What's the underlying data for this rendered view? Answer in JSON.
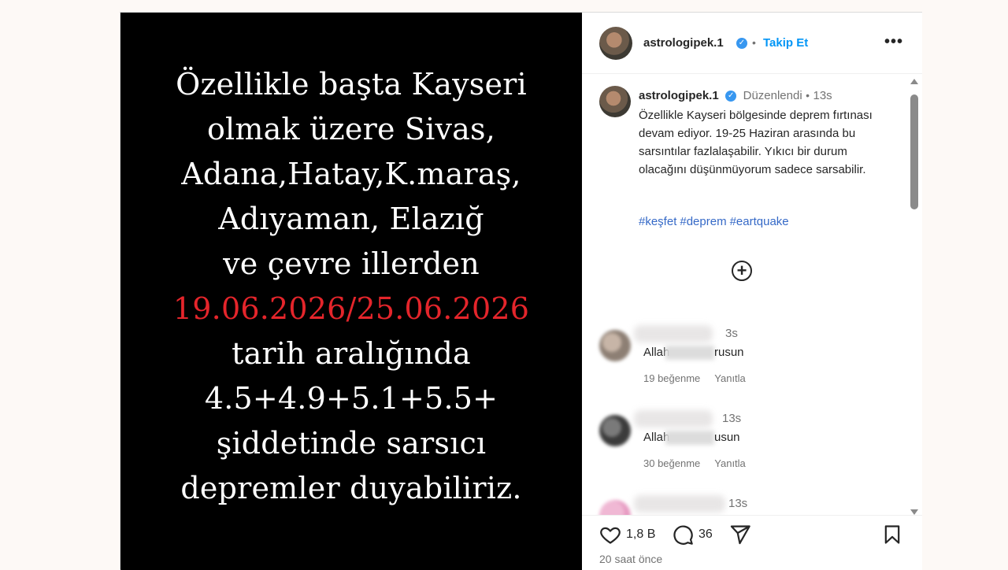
{
  "media": {
    "lines": [
      "Özellikle başta Kayseri",
      "olmak üzere Sivas,",
      "Adana,Hatay,K.maraş,",
      "Adıyaman, Elazığ",
      "ve çevre illerden",
      "19.06.2026/25.06.2026",
      "tarih aralığında",
      "4.5+4.9+5.1+5.5+",
      "şiddetinde sarsıcı",
      "depremler duyabiliriz."
    ],
    "highlight_color": "#e4252b"
  },
  "header": {
    "username": "astrologipek.1",
    "separator": "•",
    "follow_label": "Takip Et",
    "more_label": "•••"
  },
  "caption": {
    "username": "astrologipek.1",
    "edited": "Düzenlendi",
    "separator": "•",
    "time": "13s",
    "text": "Özellikle Kayseri bölgesinde deprem fırtınası devam ediyor. 19-25 Haziran arasında bu sarsıntılar fazlalaşabilir. Yıkıcı bir durum olacağını düşünmüyorum sadece sarsabilir.",
    "hashtags": [
      "#keşfet",
      "#deprem",
      "#eartquake"
    ]
  },
  "comments": [
    {
      "time": "3s",
      "text": "Allah",
      "text_rest": "rusun",
      "likes": "19 beğenme",
      "reply": "Yanıtla"
    },
    {
      "time": "13s",
      "text": "Allah",
      "text_rest": "usun",
      "likes": "30 beğenme",
      "reply": "Yanıtla"
    },
    {
      "time": "13s"
    }
  ],
  "actions": {
    "likes": "1,8 B",
    "comments": "36",
    "timestamp": "20 saat önce"
  }
}
